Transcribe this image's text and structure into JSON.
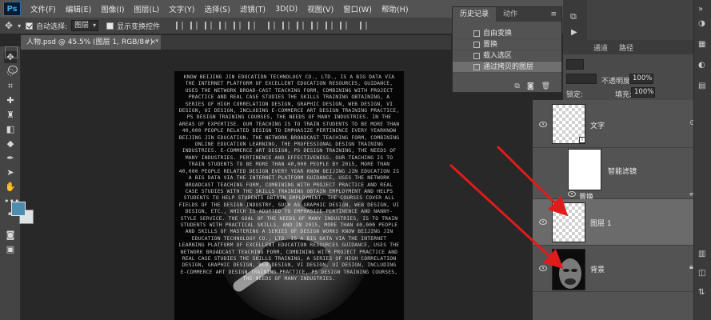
{
  "app": {
    "logo": "Ps"
  },
  "menu": [
    "文件(F)",
    "编辑(E)",
    "图像(I)",
    "图层(L)",
    "文字(Y)",
    "选择(S)",
    "滤镜(T)",
    "3D(D)",
    "视图(V)",
    "窗口(W)",
    "帮助(H)"
  ],
  "options": {
    "move_icon": "move-tool-icon",
    "auto_select_label": "自动选择:",
    "auto_select_value": "图层",
    "show_transform_label": "显示变换控件",
    "auto_select_checked": true,
    "show_transform_checked": false
  },
  "document": {
    "tab_title": "人物.psd @ 45.5% (图层 1, RGB/8#) *",
    "close": "×"
  },
  "history": {
    "tabs": [
      "历史记录",
      "动作"
    ],
    "items": [
      "自由变换",
      "置换",
      "载入选区",
      "通过拷贝的图层"
    ],
    "active_index": 3
  },
  "panel_tabs": [
    "通道",
    "路径"
  ],
  "layer_options": {
    "opacity_label": "不透明度:",
    "opacity_value": "100%",
    "fill_label": "填充:",
    "fill_value": "100%",
    "lock_label": "锁定:"
  },
  "layers": [
    {
      "name": "文字",
      "type": "text",
      "visible": true
    },
    {
      "name": "智能滤镜",
      "type": "smart-filter",
      "visible": true,
      "sub": "置换"
    },
    {
      "name": "图层 1",
      "type": "pixel",
      "visible": true,
      "selected": true
    },
    {
      "name": "背景",
      "type": "background",
      "visible": true
    }
  ],
  "poster_text": "KNOW BEIJING JIN EDUCATION TECHNOLOGY CO., LTD., IS A BIG DATA VIA THE INTERNET PLATFORM OF EXCELLENT EDUCATION RESOURCES, GUIDANCE, USES THE NETWORK BROAD-CAST TEACHING FORM, COMBINING WITH PROJECT PRACTICE AND REAL CASE STUDIES THE SKILLS TRAINING OBTAINING, A SERIES OF HIGH CORRELATION DESIGN, GRAPHIC DESIGN, WEB DESIGN, VI DESIGN, UI DESIGN, INCLUDING E-COMMERCE ART DESIGN TRAINING PRACTICE, PS DESIGN TRAINING COURSES, THE NEEDS OF MANY INDUSTRIES. IN THE AREAS OF EXPERTISE. OUR TEACHING IS TO TRAIN STUDENTS TO BE MORE THAN 40,000 PEOPLE RELATED DESIGN TO EMPHASIZE PERTINENCE EVERY YEARKNOW BEIJING JIN EDUCATION. THE NETWORK BROADCAST TEACHING FORM, COMBINING ONLINE EDUCATION LEARNING, THE PROFESSIONAL DESIGN TRAINING INDUSTRIES. E-COMMERCE ART DESIGN, PS DESIGN TRAINING, THE NEEDS OF MANY INDUSTRIES. PERTINENCE AND EFFECTIVENESS. OUR TEACHING IS TO TRAIN STUDENTS TO BE MORE THAN 40,000 PEOPLE BY 2015, MORE THAN 40,000 PEOPLE RELATED DESIGN EVERY YEAR KNOW BEIJING JIN EDUCATION IS A BIG DATA VIA THE INTERNET PLATFORM GUIDANCE, USES THE NETWORK BROADCAST TEACHING FORM, COMBINING WITH PROJECT PRACTICE AND REAL CASE STUDIES WITH THE SKILLS TRAINING OBTAIN EMPLOYMENT AND HELPS STUDENTS TO HELP STUDENTS OBTAIN EMPLOYMENT. THE COURSES COVER ALL FIELDS OF THE DESIGN INDUSTRY, SUCH AS GRAPHIC DESIGN, WEB DESIGN, UI DESIGN, ETC., WHICH IS ADOPTED TO EMPHASIZE PERTINENCE AND NANNY-STYLE SERVICE. THE GOAL OF THE NEEDS OF MANY INDUSTRIES, IS TO TRAIN STUDENTS WITH PRACTICAL SKILLS, AND IN 2015, MORE THAN 40,000 PEOPLE AND SKILLS OF MASTERING A SERIES OF DESIGN WORKS KNOW BEIJING JIN EDUCATION TECHNOLOGY CO., LTD. IS A BIG DATA VIA THE INTERNET LEARNING PLATFORM OF EXCELLENT EDUCATION RESOURCES GUIDANCE, USES THE NETWORK BROADCAST TEACHING FORM, COMBINING WITH PROJECT PRACTICE AND REAL CASE STUDIES THE SKILLS TRAINING, A SERIES OF HIGH CORRELATION DESIGN, GRAPHIC DESIGN, WEB DESIGN, VI DESIGN, UI DESIGN, INCLUDING E-COMMERCE ART DESIGN TRAINING PRACTICE, PS DESIGN TRAINING COURSES, THE NEEDS OF MANY INDUSTRIES.",
  "colors": {
    "foreground": "#4d8eb0",
    "background": "#dde4e8",
    "arrow": "#e01b1b"
  }
}
